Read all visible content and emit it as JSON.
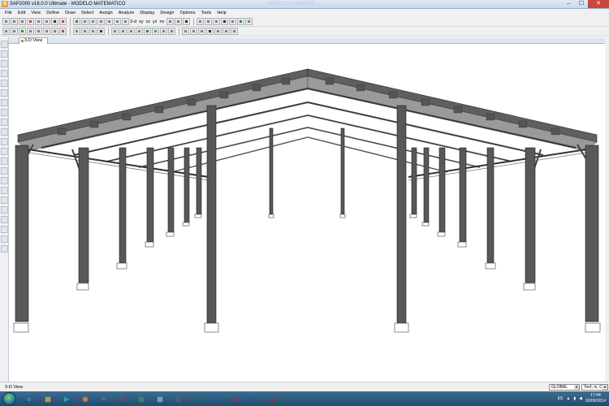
{
  "window": {
    "title": "SAP2000 v16.0.0 Ultimate  -  MODELO MATEMATICO",
    "faded_title": "MODELO CUBIERTA ...",
    "buttons": {
      "minimize": "–",
      "maximize": "☐",
      "close": "✕"
    }
  },
  "menu": [
    "File",
    "Edit",
    "View",
    "Define",
    "Draw",
    "Select",
    "Assign",
    "Analyze",
    "Display",
    "Design",
    "Options",
    "Tools",
    "Help"
  ],
  "toolbar": {
    "view_labels": [
      "3-d",
      "xy",
      "xz",
      "yz",
      "nv"
    ]
  },
  "tab": {
    "label": "3-D View"
  },
  "status": {
    "text": "3-D View",
    "coord_system": "GLOBAL",
    "units": "Tonf, m, C"
  },
  "taskbar": {
    "apps": [
      {
        "icon": "ie-icon",
        "glyph": "e",
        "color": "#3a8fd6"
      },
      {
        "icon": "explorer-icon",
        "glyph": "▤",
        "color": "#d9b14a"
      },
      {
        "icon": "media-player-icon",
        "glyph": "▶",
        "color": "#2c9de0"
      },
      {
        "icon": "firefox-icon",
        "glyph": "◉",
        "color": "#e9792b"
      },
      {
        "icon": "sap2000-icon",
        "glyph": "⟁",
        "color": "#5b6c80"
      },
      {
        "icon": "app-x-icon",
        "glyph": "X",
        "color": "#c0392b"
      },
      {
        "icon": "chrome-icon",
        "glyph": "◎",
        "color": "#4aa848"
      },
      {
        "icon": "notepad-icon",
        "glyph": "▦",
        "color": "#7aa6c9"
      },
      {
        "icon": "media-icon",
        "glyph": "▣",
        "color": "#555d66"
      },
      {
        "icon": "excel-icon",
        "glyph": "X",
        "color": "#1e7a3e"
      },
      {
        "icon": "outlook-icon",
        "glyph": "O",
        "color": "#2a62b0"
      },
      {
        "icon": "autocad-icon",
        "glyph": "A",
        "color": "#c62828"
      },
      {
        "icon": "word-icon",
        "glyph": "W",
        "color": "#2b579a"
      },
      {
        "icon": "app-red-icon",
        "glyph": "▲",
        "color": "#b8321f"
      }
    ],
    "language": "ES",
    "time": "17:44",
    "date": "02/06/2014"
  }
}
